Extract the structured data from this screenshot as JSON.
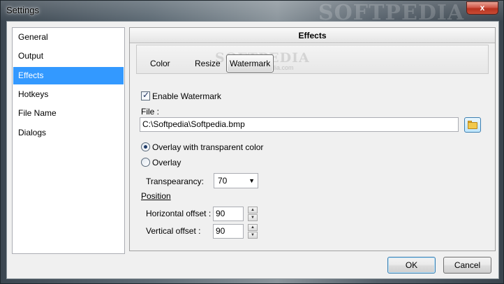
{
  "window": {
    "title": "Settings",
    "close_glyph": "x",
    "background_watermark": "SOFTPEDIA"
  },
  "sidebar": {
    "items": [
      {
        "label": "General",
        "selected": false
      },
      {
        "label": "Output",
        "selected": false
      },
      {
        "label": "Effects",
        "selected": true
      },
      {
        "label": "Hotkeys",
        "selected": false
      },
      {
        "label": "File Name",
        "selected": false
      },
      {
        "label": "Dialogs",
        "selected": false
      }
    ]
  },
  "panel": {
    "title": "Effects",
    "tabs": [
      {
        "label": "Color",
        "active": false
      },
      {
        "label": "Resize",
        "active": false
      },
      {
        "label": "Watermark",
        "active": true
      }
    ],
    "overlay_watermark": "SOFTPEDIA",
    "overlay_url": "www.softpedia.com"
  },
  "watermark": {
    "enable_label": "Enable Watermark",
    "enable_checked": true,
    "file_label": "File  :",
    "file_value": "C:\\Softpedia\\Softpedia.bmp",
    "browse_icon": "folder-open-icon",
    "overlay_transparent_label": "Overlay with transparent color",
    "overlay_transparent_selected": true,
    "overlay_label": "Overlay",
    "overlay_selected": false,
    "transparency_label": "Transpearancy:",
    "transparency_value": "70",
    "position_label": "Position",
    "horizontal_label": "Horizontal offset :",
    "horizontal_value": "90",
    "vertical_label": "Vertical offset    :",
    "vertical_value": "90"
  },
  "footer": {
    "ok_label": "OK",
    "cancel_label": "Cancel"
  },
  "colors": {
    "selection": "#3399ff",
    "close_button": "#c84c35",
    "dialog_bg": "#f0f0f0"
  }
}
